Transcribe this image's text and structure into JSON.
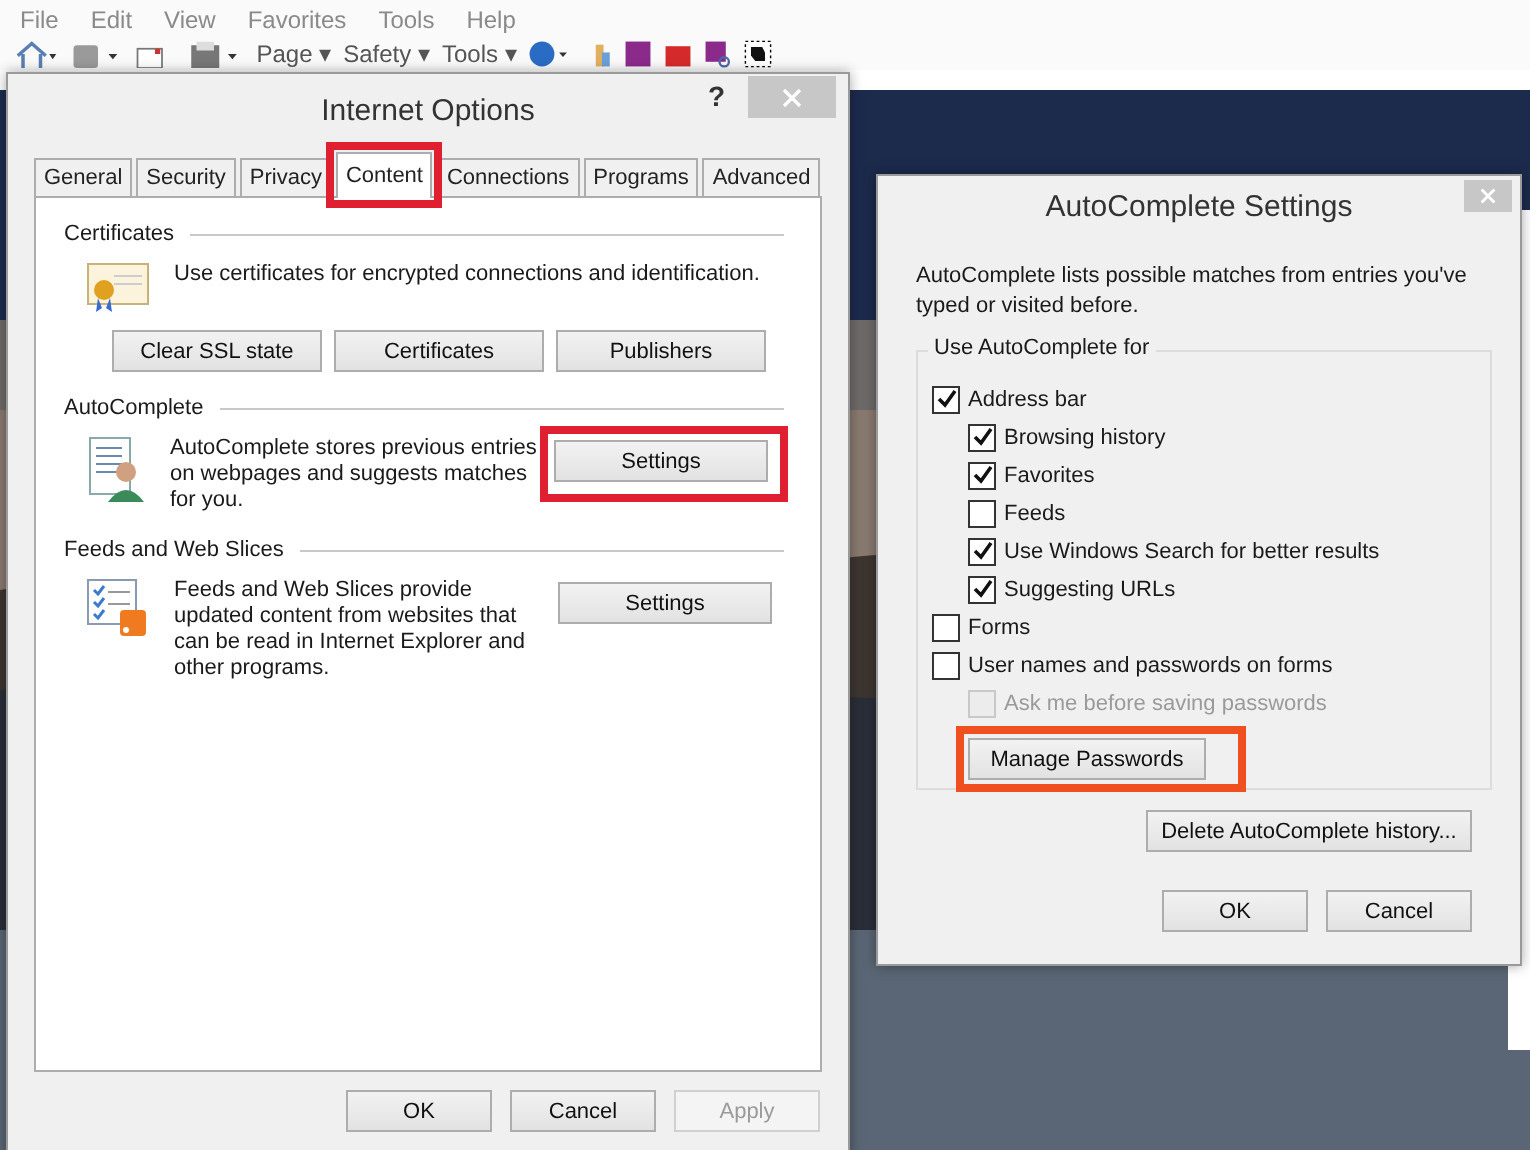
{
  "menu_bar": [
    "File",
    "Edit",
    "View",
    "Favorites",
    "Tools",
    "Help"
  ],
  "toolbar": [
    {
      "label": "Page ▾"
    },
    {
      "label": "Safety ▾"
    },
    {
      "label": "Tools ▾"
    }
  ],
  "internet_options": {
    "title": "Internet Options",
    "help": "?",
    "tabs": [
      {
        "label": "General",
        "selected": false,
        "highlighted": false
      },
      {
        "label": "Security",
        "selected": false,
        "highlighted": false
      },
      {
        "label": "Privacy",
        "selected": false,
        "highlighted": false
      },
      {
        "label": "Content",
        "selected": true,
        "highlighted": true
      },
      {
        "label": "Connections",
        "selected": false,
        "highlighted": false
      },
      {
        "label": "Programs",
        "selected": false,
        "highlighted": false
      },
      {
        "label": "Advanced",
        "selected": false,
        "highlighted": false
      }
    ],
    "sections": [
      {
        "kind": "row",
        "title": "Certificates",
        "description": "Use certificates for encrypted connections and identification.",
        "buttons": [
          {
            "label": "Clear SSL state",
            "highlighted": false
          },
          {
            "label": "Certificates",
            "highlighted": false
          },
          {
            "label": "Publishers",
            "highlighted": false
          }
        ]
      },
      {
        "kind": "side",
        "title": "AutoComplete",
        "description": "AutoComplete stores previous entries on webpages and suggests matches for you.",
        "buttons": [
          {
            "label": "Settings",
            "highlighted": true
          }
        ]
      },
      {
        "kind": "side",
        "title": "Feeds and Web Slices",
        "description": "Feeds and Web Slices provide updated content from websites that can be read in Internet Explorer and other programs.",
        "buttons": [
          {
            "label": "Settings",
            "highlighted": false
          }
        ]
      }
    ],
    "footer_buttons": [
      {
        "label": "OK",
        "disabled": false
      },
      {
        "label": "Cancel",
        "disabled": false
      },
      {
        "label": "Apply",
        "disabled": true
      }
    ]
  },
  "autocomplete_settings": {
    "title": "AutoComplete Settings",
    "intro": "AutoComplete lists possible matches from entries you've typed or visited before.",
    "group_title": "Use AutoComplete for",
    "options": [
      {
        "label": "Address bar",
        "checked": true,
        "disabled": false,
        "children": [
          {
            "label": "Browsing history",
            "checked": true,
            "disabled": false
          },
          {
            "label": "Favorites",
            "checked": true,
            "disabled": false
          },
          {
            "label": "Feeds",
            "checked": false,
            "disabled": false
          },
          {
            "label": "Use Windows Search for better results",
            "checked": true,
            "disabled": false
          },
          {
            "label": "Suggesting URLs",
            "checked": true,
            "disabled": false
          }
        ]
      },
      {
        "label": "Forms",
        "checked": false,
        "disabled": false
      },
      {
        "label": "User names and passwords on forms",
        "checked": false,
        "disabled": false,
        "children": [
          {
            "label": "Ask me before saving passwords",
            "checked": false,
            "disabled": true
          }
        ]
      }
    ],
    "manage_button": {
      "label": "Manage Passwords",
      "highlighted": true
    },
    "delete_button": "Delete AutoComplete history...",
    "footer_buttons": [
      {
        "label": "OK",
        "disabled": false
      },
      {
        "label": "Cancel",
        "disabled": false
      }
    ]
  }
}
